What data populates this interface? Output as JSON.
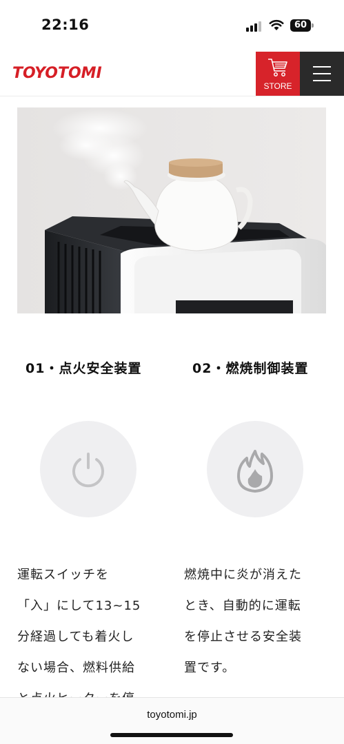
{
  "status": {
    "time": "22:16",
    "battery": "60",
    "signal_icon": "cellular-signal-icon",
    "wifi_icon": "wifi-icon",
    "battery_icon": "battery-icon"
  },
  "header": {
    "logo_text": "TOYOTOMI",
    "store_label": "STORE",
    "store_icon": "cart-icon",
    "menu_icon": "hamburger-menu-icon",
    "brand_color": "#d7232a"
  },
  "hero": {
    "image_description_icon": "kettle-on-heater-photo"
  },
  "features": [
    {
      "title": "01・点火安全装置",
      "icon": "power-icon",
      "description_lines": [
        "運転スイッチを",
        "「入」にして13~15",
        "分経過しても着火し",
        "ない場合、燃料供給",
        "と点火ヒーターを停"
      ]
    },
    {
      "title": "02・燃焼制御装置",
      "icon": "flame-icon",
      "description_lines": [
        "燃焼中に炎が消えた",
        "とき、自動的に運転",
        "を停止させる安全装",
        "置です。"
      ]
    }
  ],
  "browser": {
    "url": "toyotomi.jp"
  }
}
